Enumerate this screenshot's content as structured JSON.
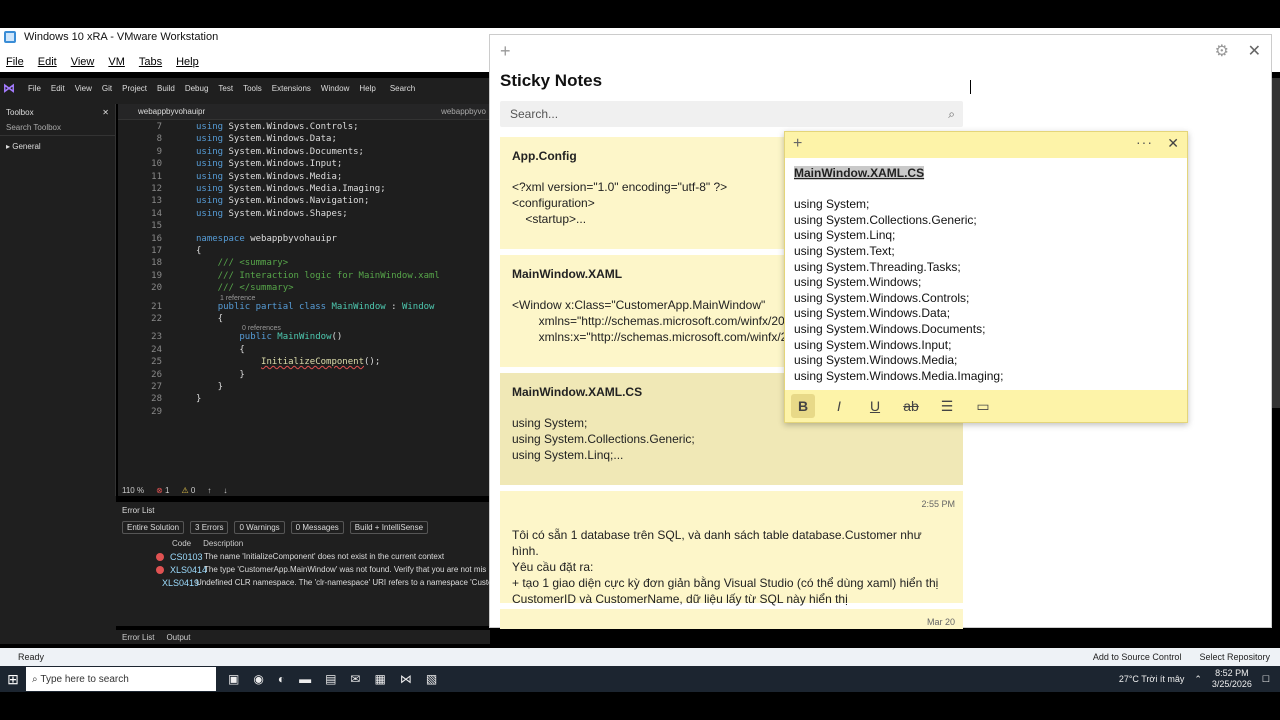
{
  "vmware": {
    "window_title": "Windows 10 xRA - VMware Workstation",
    "menu": [
      "File",
      "Edit",
      "View",
      "VM",
      "Tabs",
      "Help"
    ],
    "status_ready": "Ready",
    "status_right": [
      "Add to Source Control",
      "Select Repository"
    ]
  },
  "vs": {
    "menu": [
      "File",
      "Edit",
      "View",
      "Git",
      "Project",
      "Build",
      "Debug",
      "Test",
      "Tools",
      "Extensions",
      "Window",
      "Help",
      "Search"
    ],
    "toolbox_title": "Toolbox",
    "toolbox_search": "Search Toolbox",
    "toolbox_general": "General",
    "editor_tab": "webappbyvohauipr",
    "editor_tab2": "webappbyvo",
    "code_lines": [
      {
        "n": "7",
        "text": "using System.Windows.Controls;"
      },
      {
        "n": "8",
        "text": "using System.Windows.Data;"
      },
      {
        "n": "9",
        "text": "using System.Windows.Documents;"
      },
      {
        "n": "10",
        "text": "using System.Windows.Input;"
      },
      {
        "n": "11",
        "text": "using System.Windows.Media;"
      },
      {
        "n": "12",
        "text": "using System.Windows.Media.Imaging;"
      },
      {
        "n": "13",
        "text": "using System.Windows.Navigation;"
      },
      {
        "n": "14",
        "text": "using System.Windows.Shapes;"
      },
      {
        "n": "15",
        "text": ""
      },
      {
        "n": "16",
        "text": "namespace webappbyvohauipr"
      },
      {
        "n": "17",
        "text": "{"
      },
      {
        "n": "18",
        "text": "    /// <summary>"
      },
      {
        "n": "19",
        "text": "    /// Interaction logic for MainWindow.xaml"
      },
      {
        "n": "20",
        "text": "    /// </summary>"
      },
      {
        "n": "21",
        "text": "    public partial class MainWindow : Window"
      },
      {
        "n": "22",
        "text": "    {"
      },
      {
        "n": "23",
        "text": "        public MainWindow()"
      },
      {
        "n": "24",
        "text": "        {"
      },
      {
        "n": "25",
        "text": "            InitializeComponent();"
      },
      {
        "n": "26",
        "text": "        }"
      },
      {
        "n": "27",
        "text": "    }"
      },
      {
        "n": "28",
        "text": "}"
      },
      {
        "n": "29",
        "text": ""
      }
    ],
    "ref_1": "1 reference",
    "ref_0": "0 references",
    "zoom": "110 %",
    "err_count": "1",
    "warn_count": "0",
    "errlist": {
      "title": "Error List",
      "scope": "Entire Solution",
      "errors": "3 Errors",
      "warnings": "0 Warnings",
      "messages": "0 Messages",
      "build": "Build + IntelliSense",
      "col_code": "Code",
      "col_desc": "Description",
      "rows": [
        {
          "code": "CS0103",
          "desc": "The name 'InitializeComponent' does not exist in the current context"
        },
        {
          "code": "XLS0414",
          "desc": "The type 'CustomerApp.MainWindow' was not found. Verify that you are not mis"
        },
        {
          "code": "XLS0419",
          "desc": "Undefined CLR namespace. The 'clr-namespace' URI refers to a namespace 'Custo"
        }
      ]
    },
    "bottom_tabs": [
      "Error List",
      "Output"
    ]
  },
  "sticky": {
    "title": "Sticky Notes",
    "search_placeholder": "Search...",
    "notes": [
      {
        "title": "App.Config",
        "body": "<?xml version=\"1.0\" encoding=\"utf-8\" ?>\n<configuration>\n    <startup>...",
        "ts": ""
      },
      {
        "title": "MainWindow.XAML",
        "body": "<Window x:Class=\"CustomerApp.MainWindow\"\n        xmlns=\"http://schemas.microsoft.com/winfx/20\n        xmlns:x=\"http://schemas.microsoft.com/winfx/2",
        "ts": ""
      },
      {
        "title": "MainWindow.XAML.CS",
        "body": "using System;\nusing System.Collections.Generic;\nusing System.Linq;...",
        "ts": ""
      },
      {
        "title": "",
        "body": "Tôi có sẵn 1 database trên SQL, và danh sách table database.Customer như hình.\nYêu cầu đặt ra:\n+ tạo 1 giao diện cực kỳ đơn giản bằng Visual Studio (có thể dùng xaml) hiển thị\nCustomerID và CustomerName, dữ liệu lấy từ SQL này hiển thị",
        "ts": "2:55 PM"
      },
      {
        "title": "",
        "body": "",
        "ts": "Mar 20"
      }
    ],
    "open_note": {
      "heading": "MainWindow.XAML.CS",
      "lines": [
        "using System;",
        "using System.Collections.Generic;",
        "using System.Linq;",
        "using System.Text;",
        "using System.Threading.Tasks;",
        "using System.Windows;",
        "using System.Windows.Controls;",
        "using System.Windows.Data;",
        "using System.Windows.Documents;",
        "using System.Windows.Input;",
        "using System.Windows.Media;",
        "using System.Windows.Media.Imaging;"
      ],
      "tools": {
        "bold": "B",
        "italic": "I",
        "underline": "U",
        "strike": "ab"
      }
    }
  },
  "taskbar": {
    "search_placeholder": "Type here to search",
    "weather": "27°C  Trời ít mây",
    "time": "8:52 PM",
    "date": "3/25/2026"
  }
}
